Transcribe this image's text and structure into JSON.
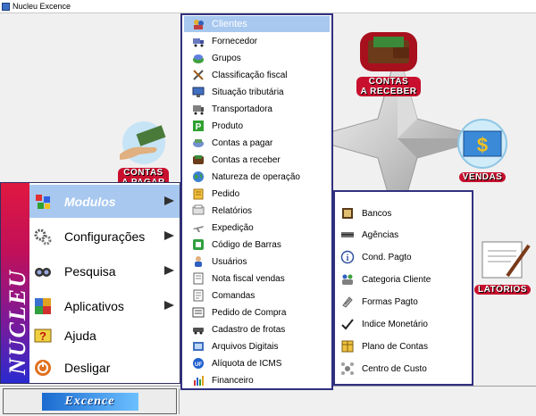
{
  "window": {
    "title": "Nucleu Excence"
  },
  "desktop": {
    "shortcuts": {
      "receber": [
        "CONTAS",
        "A RECEBER"
      ],
      "pagar": [
        "CONTAS",
        "A PAGAR"
      ],
      "vendas": "VENDAS",
      "relatorios": "LATÓRIOS"
    }
  },
  "start_menu": {
    "brand_text": "NUCLEU",
    "items": [
      {
        "label": "Modulos",
        "has_submenu": true,
        "active": true
      },
      {
        "label": "Configurações",
        "has_submenu": true
      },
      {
        "label": "Pesquisa",
        "has_submenu": true
      },
      {
        "label": "Aplicativos",
        "has_submenu": true
      },
      {
        "label": "Ajuda"
      },
      {
        "label": "Desligar"
      }
    ]
  },
  "taskbar": {
    "logo_text": "Excence"
  },
  "modulos_submenu": {
    "items": [
      "Clientes",
      "Fornecedor",
      "Grupos",
      "Classificação fiscal",
      "Situação tributária",
      "Transportadora",
      "Produto",
      "Contas a pagar",
      "Contas a receber",
      "Natureza de operação",
      "Pedido",
      "Relatórios",
      "Expedição",
      "Código de Barras",
      "Usuários",
      "Nota fiscal vendas",
      "Comandas",
      "Pedido de Compra",
      "Cadastro de frotas",
      "Arquivos Digitais",
      "Alíquota de ICMS",
      "Financeiro"
    ],
    "active_index": 0,
    "icon_badges": {
      "icms": "UF"
    }
  },
  "financeiro_submenu": {
    "items": [
      "Bancos",
      "Agências",
      "Cond. Pagto",
      "Categoria Cliente",
      "Formas Pagto",
      "Indice Monetário",
      "Plano de Contas",
      "Centro de Custo"
    ]
  }
}
